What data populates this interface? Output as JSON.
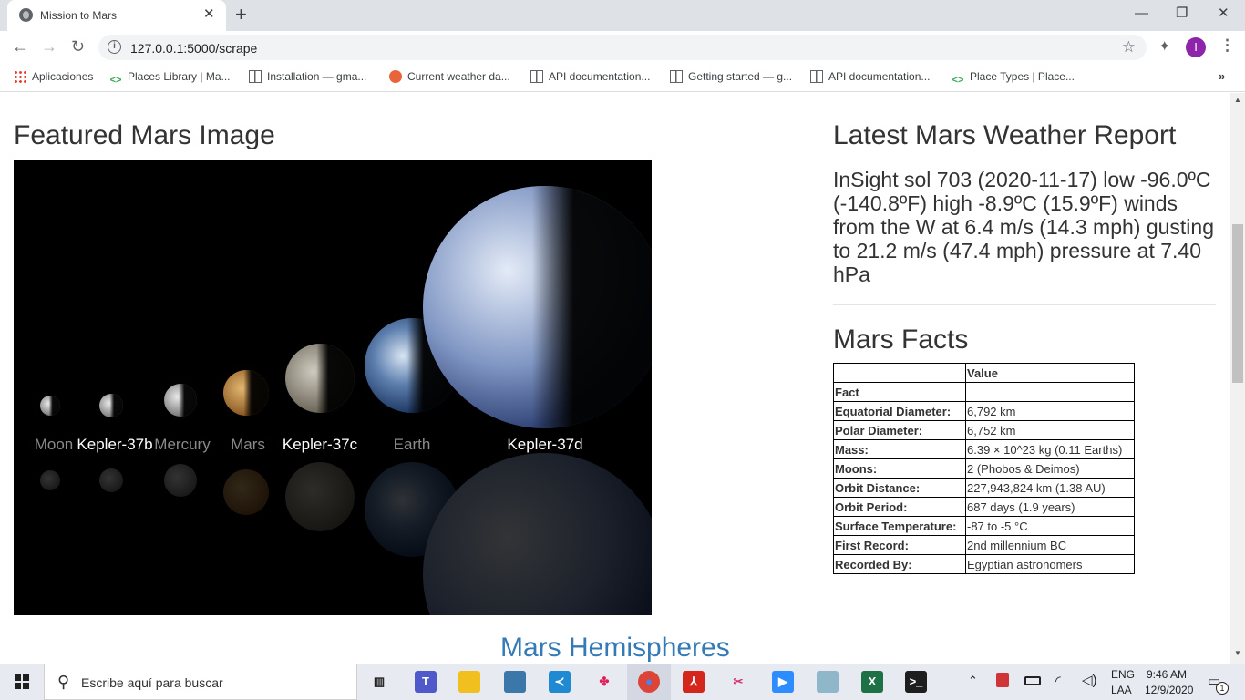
{
  "browser": {
    "tab_title": "Mission to Mars",
    "tab_close": "✕",
    "new_tab": "+",
    "url": "127.0.0.1:5000/scrape",
    "window": {
      "minimize": "—",
      "restore": "❐",
      "close": "✕"
    },
    "nav": {
      "back": "←",
      "forward": "→",
      "reload": "↻"
    },
    "avatar_letter": "I",
    "bookmarks": [
      {
        "label": "Aplicaciones",
        "icon": "apps-grid-icon"
      },
      {
        "label": "Places Library  |  Ma...",
        "icon": "code-icon"
      },
      {
        "label": "Installation — gma...",
        "icon": "doc-icon"
      },
      {
        "label": "Current weather da...",
        "icon": "weather-icon"
      },
      {
        "label": "API documentation...",
        "icon": "doc-icon"
      },
      {
        "label": "Getting started — g...",
        "icon": "doc-icon"
      },
      {
        "label": "API documentation...",
        "icon": "doc-icon"
      },
      {
        "label": "Place Types  |  Place...",
        "icon": "code-icon"
      }
    ],
    "bookmarks_more": "»"
  },
  "page": {
    "featured_title": "Featured Mars Image",
    "planet_labels": [
      "Moon",
      "Kepler-37b",
      "Mercury",
      "Mars",
      "Kepler-37c",
      "Earth",
      "Kepler-37d"
    ],
    "weather_title": "Latest Mars Weather Report",
    "weather_text": "InSight sol 703 (2020-11-17) low -96.0ºC (-140.8ºF) high -8.9ºC (15.9ºF) winds from the W at 6.4 m/s (14.3 mph) gusting to 21.2 m/s (47.4 mph) pressure at 7.40 hPa",
    "facts_title": "Mars Facts",
    "facts_table": {
      "header_value": "Value",
      "header_fact": "Fact",
      "rows": [
        {
          "k": "Equatorial Diameter:",
          "v": "6,792 km"
        },
        {
          "k": "Polar Diameter:",
          "v": "6,752 km"
        },
        {
          "k": "Mass:",
          "v": "6.39 × 10^23 kg (0.11 Earths)"
        },
        {
          "k": "Moons:",
          "v": "2 (Phobos & Deimos)"
        },
        {
          "k": "Orbit Distance:",
          "v": "227,943,824 km (1.38 AU)"
        },
        {
          "k": "Orbit Period:",
          "v": "687 days (1.9 years)"
        },
        {
          "k": "Surface Temperature:",
          "v": "-87 to -5 °C"
        },
        {
          "k": "First Record:",
          "v": "2nd millennium BC"
        },
        {
          "k": "Recorded By:",
          "v": "Egyptian astronomers"
        }
      ]
    },
    "hemispheres_title": "Mars Hemispheres"
  },
  "taskbar": {
    "search_placeholder": "Escribe aquí para buscar",
    "language_top": "ENG",
    "language_bottom": "LAA",
    "time": "9:46 AM",
    "date": "12/9/2020",
    "notification_count": "1",
    "apps": [
      "task-view-icon",
      "teams-icon",
      "file-explorer-icon",
      "python-icon",
      "vscode-icon",
      "slack-icon",
      "chrome-icon",
      "acrobat-icon",
      "snipping-icon",
      "zoom-icon",
      "app-icon",
      "excel-icon",
      "terminal-icon"
    ]
  }
}
